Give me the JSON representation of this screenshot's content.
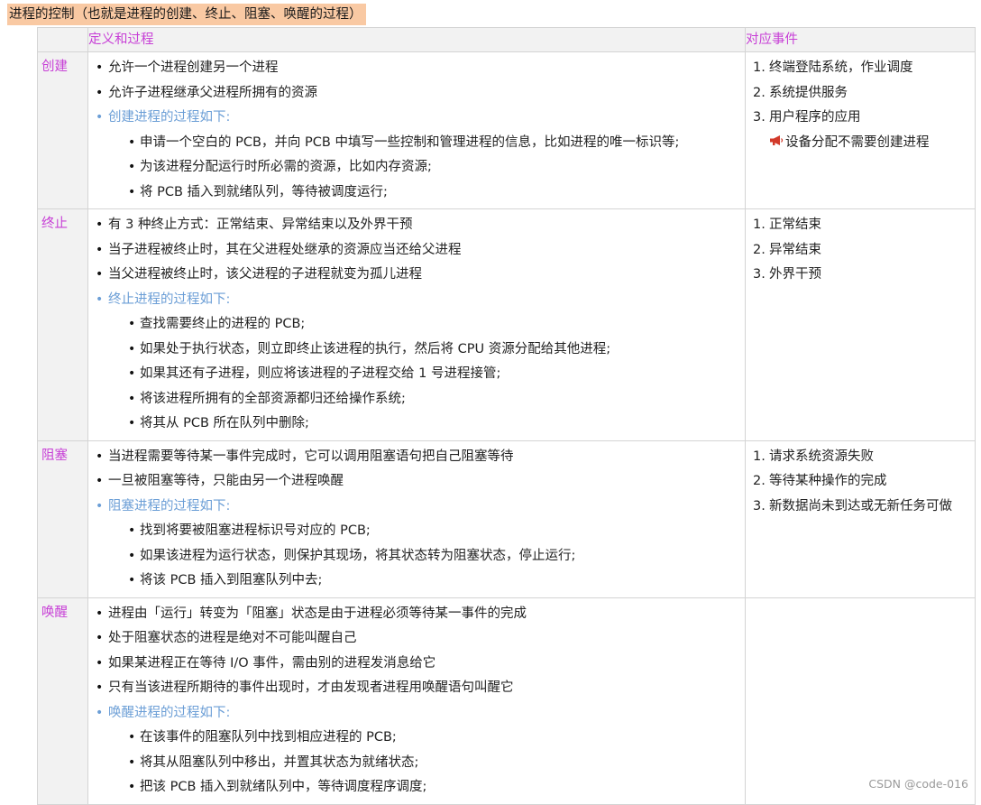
{
  "title": "进程的控制（也就是进程的创建、终止、阻塞、唤醒的过程）",
  "table": {
    "headers": [
      "",
      "定义和过程",
      "对应事件"
    ],
    "rows": [
      {
        "label": "创建",
        "definitions": [
          {
            "level": 1,
            "text": "允许一个进程创建另一个进程"
          },
          {
            "level": 1,
            "text": "允许子进程继承父进程所拥有的资源"
          },
          {
            "level": 1,
            "text": "创建进程的过程如下:",
            "sub": true
          },
          {
            "level": 2,
            "text": "申请一个空白的 PCB，并向 PCB 中填写一些控制和管理进程的信息，比如进程的唯一标识等;"
          },
          {
            "level": 2,
            "text": "为该进程分配运行时所必需的资源，比如内存资源;"
          },
          {
            "level": 2,
            "text": "将 PCB 插入到就绪队列，等待被调度运行;"
          }
        ],
        "events": [
          "终端登陆系统，作业调度",
          "系统提供服务",
          "用户程序的应用"
        ],
        "note": "设备分配不需要创建进程",
        "note_icon": "megaphone-icon"
      },
      {
        "label": "终止",
        "definitions": [
          {
            "level": 1,
            "text": "有 3 种终止方式：正常结束、异常结束以及外界干预"
          },
          {
            "level": 1,
            "text": "当子进程被终止时，其在父进程处继承的资源应当还给父进程"
          },
          {
            "level": 1,
            "text": "当父进程被终止时，该父进程的子进程就变为孤儿进程"
          },
          {
            "level": 1,
            "text": "终止进程的过程如下:",
            "sub": true
          },
          {
            "level": 2,
            "text": "查找需要终止的进程的 PCB;"
          },
          {
            "level": 2,
            "text": "如果处于执行状态，则立即终止该进程的执行，然后将 CPU 资源分配给其他进程;"
          },
          {
            "level": 2,
            "text": "如果其还有子进程，则应将该进程的子进程交给 1 号进程接管;"
          },
          {
            "level": 2,
            "text": "将该进程所拥有的全部资源都归还给操作系统;"
          },
          {
            "level": 2,
            "text": "将其从 PCB 所在队列中删除;"
          }
        ],
        "events": [
          "正常结束",
          "异常结束",
          "外界干预"
        ]
      },
      {
        "label": "阻塞",
        "definitions": [
          {
            "level": 1,
            "text": "当进程需要等待某一事件完成时，它可以调用阻塞语句把自己阻塞等待"
          },
          {
            "level": 1,
            "text": "一旦被阻塞等待，只能由另一个进程唤醒"
          },
          {
            "level": 1,
            "text": "阻塞进程的过程如下:",
            "sub": true
          },
          {
            "level": 2,
            "text": "找到将要被阻塞进程标识号对应的 PCB;"
          },
          {
            "level": 2,
            "text": "如果该进程为运行状态，则保护其现场，将其状态转为阻塞状态，停止运行;"
          },
          {
            "level": 2,
            "text": "将该 PCB 插入到阻塞队列中去;"
          }
        ],
        "events": [
          "请求系统资源失败",
          "等待某种操作的完成",
          "新数据尚未到达或无新任务可做"
        ]
      },
      {
        "label": "唤醒",
        "definitions": [
          {
            "level": 1,
            "text": "进程由「运行」转变为「阻塞」状态是由于进程必须等待某一事件的完成"
          },
          {
            "level": 1,
            "text": "处于阻塞状态的进程是绝对不可能叫醒自己"
          },
          {
            "level": 1,
            "text": "如果某进程正在等待 I/O 事件，需由别的进程发消息给它"
          },
          {
            "level": 1,
            "text": "只有当该进程所期待的事件出现时，才由发现者进程用唤醒语句叫醒它"
          },
          {
            "level": 1,
            "text": "唤醒进程的过程如下:",
            "sub": true
          },
          {
            "level": 2,
            "text": "在该事件的阻塞队列中找到相应进程的 PCB;"
          },
          {
            "level": 2,
            "text": "将其从阻塞队列中移出，并置其状态为就绪状态;"
          },
          {
            "level": 2,
            "text": "把该 PCB 插入到就绪队列中，等待调度程序调度;"
          }
        ],
        "events": []
      }
    ]
  },
  "watermark": "CSDN @code-016",
  "colors": {
    "heading_bg": "#f9c9a3",
    "label_text": "#c73fd6",
    "sub_bullet_text": "#6b9ed6",
    "header_bg": "#f2f2f2"
  }
}
